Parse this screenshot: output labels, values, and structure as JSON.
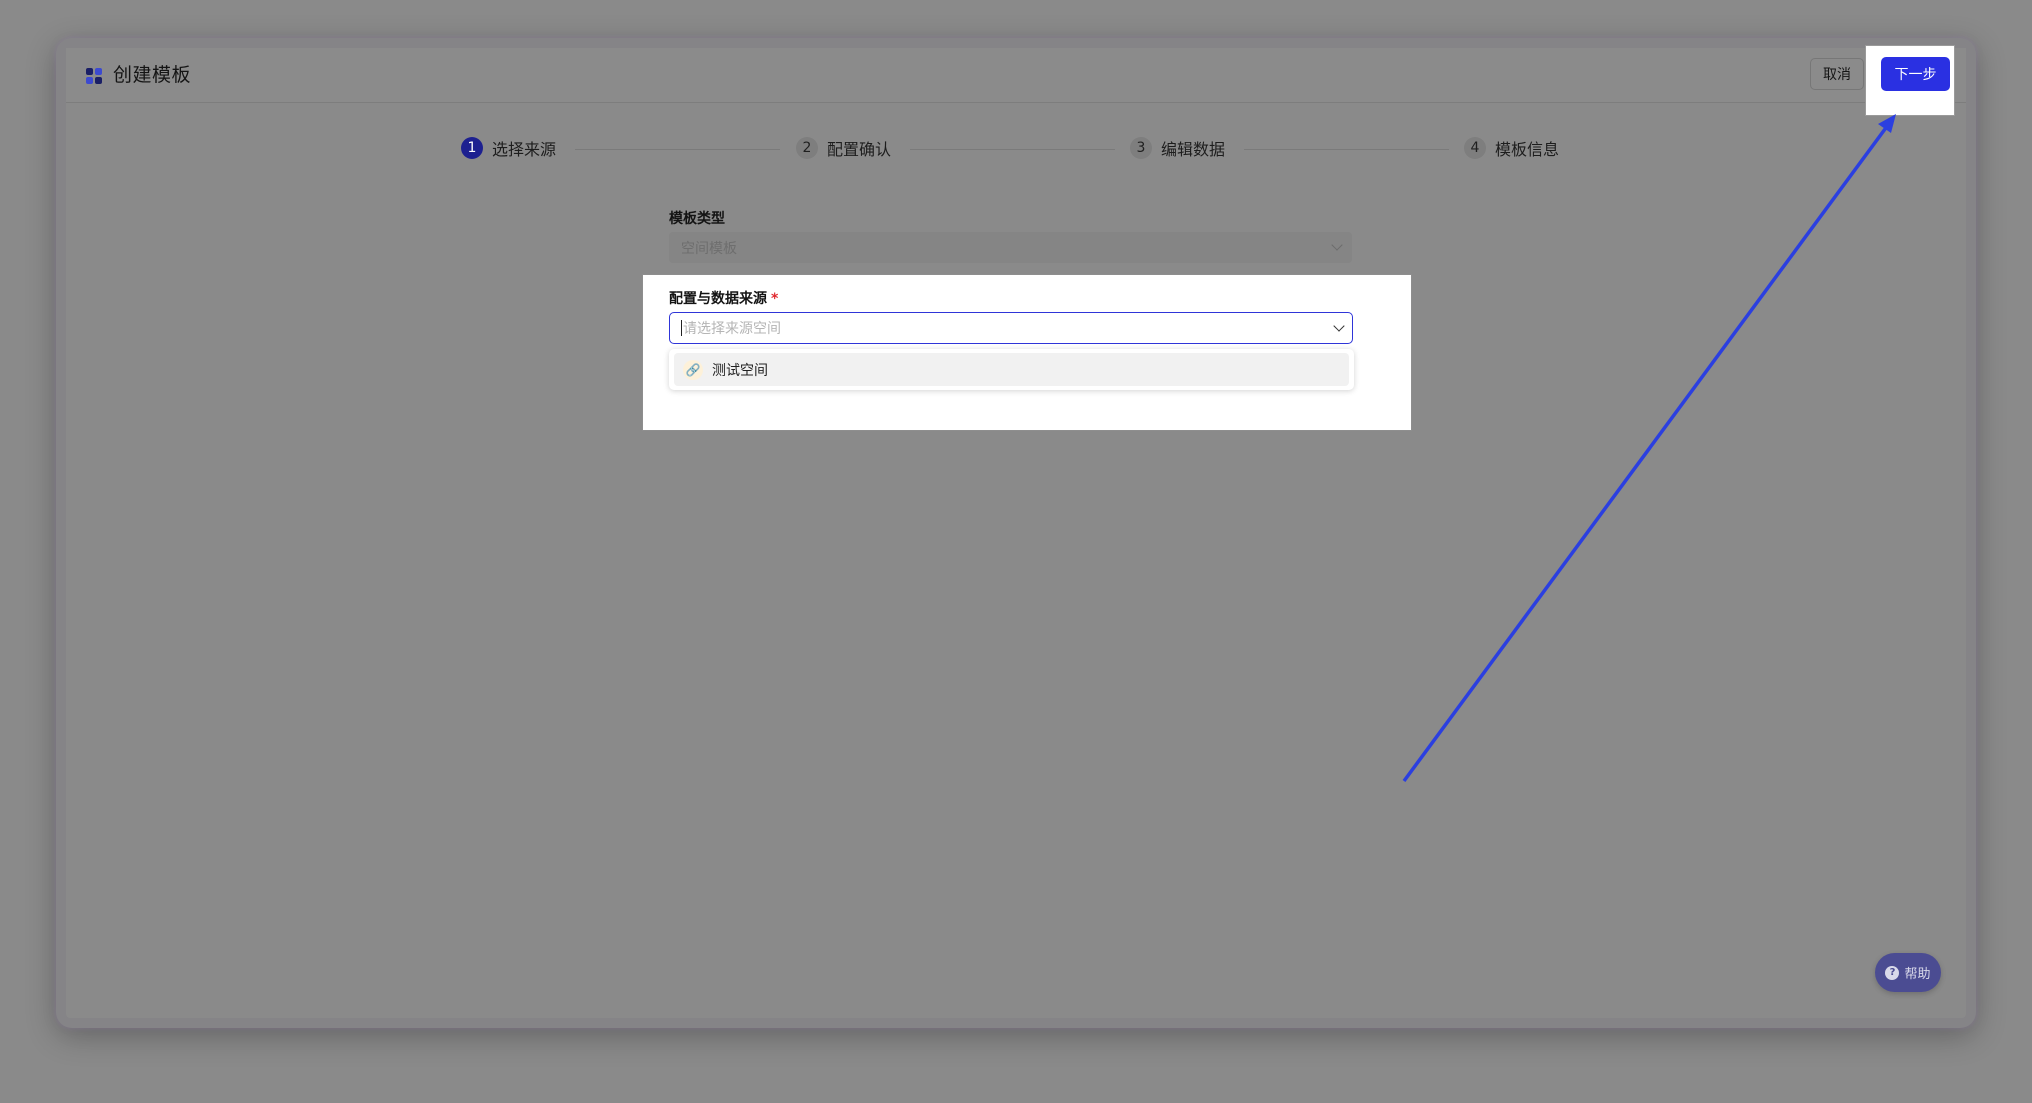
{
  "header": {
    "title": "创建模板",
    "cancel_label": "取消",
    "next_label": "下一步"
  },
  "steps": [
    {
      "num": "1",
      "label": "选择来源",
      "active": true
    },
    {
      "num": "2",
      "label": "配置确认",
      "active": false
    },
    {
      "num": "3",
      "label": "编辑数据",
      "active": false
    },
    {
      "num": "4",
      "label": "模板信息",
      "active": false
    }
  ],
  "form": {
    "template_type": {
      "label": "模板类型",
      "value": "空间模板"
    },
    "source": {
      "label": "配置与数据来源",
      "required_mark": "*",
      "placeholder": "请选择来源空间",
      "options": [
        {
          "label": "测试空间",
          "icon": "link-icon"
        }
      ]
    }
  },
  "help": {
    "label": "帮助",
    "icon": "question-icon"
  },
  "colors": {
    "primary": "#2a30e2",
    "step_active": "#1d2090",
    "annotation_arrow": "#2b3fe0"
  }
}
